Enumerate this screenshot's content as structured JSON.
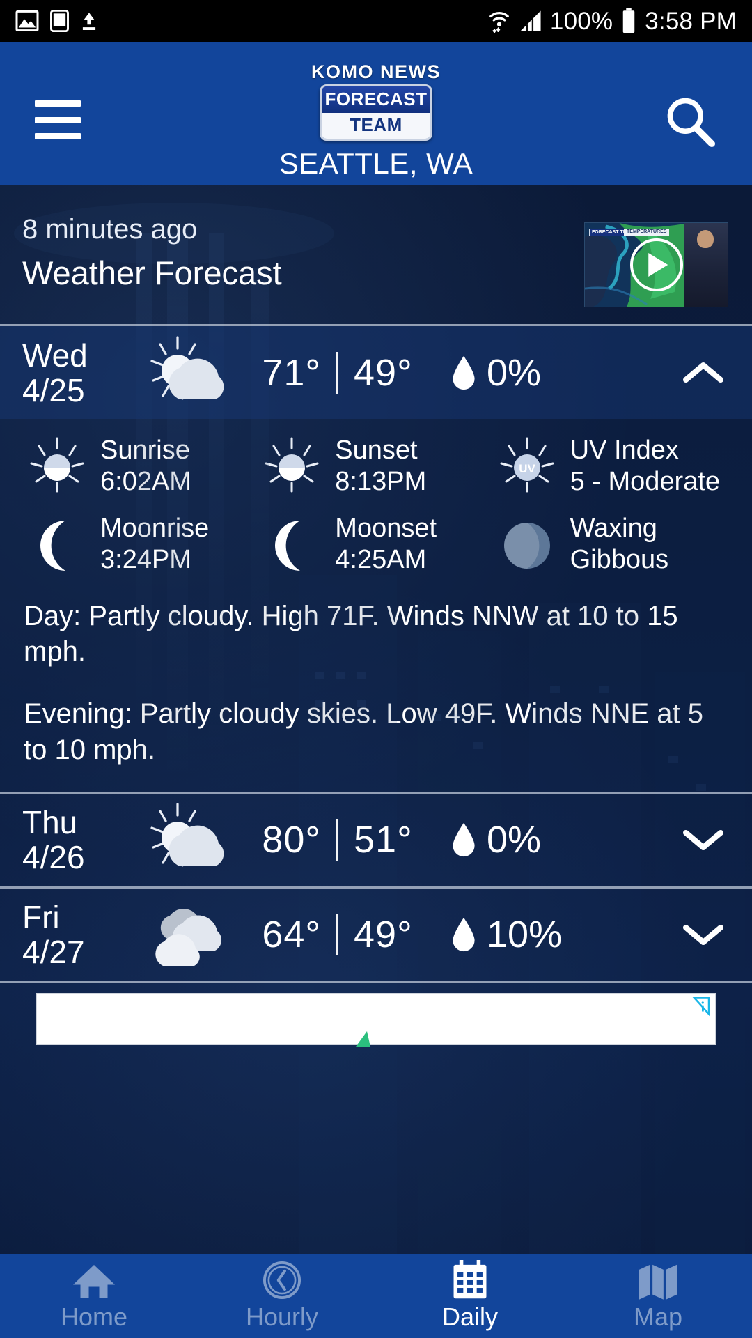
{
  "status_bar": {
    "icons_left": [
      "image-icon",
      "cast-screen-icon",
      "upload-icon"
    ],
    "icons_right": [
      "wifi-icon",
      "cell-signal-icon",
      "battery-icon"
    ],
    "battery": "100%",
    "time": "3:58 PM"
  },
  "header": {
    "menu_icon": "hamburger-menu-icon",
    "search_icon": "search-icon",
    "logo_line1": "KOMO NEWS",
    "logo_line2": "FORECAST",
    "logo_line3": "TEAM",
    "location": "SEATTLE, WA",
    "background_color": "#12459b"
  },
  "video": {
    "timestamp": "8 minutes ago",
    "title": "Weather Forecast",
    "play_icon": "play-button-icon",
    "thumbnail_label_1": "FORECAST TEAM",
    "thumbnail_label_2": "TEMPERATURES"
  },
  "forecast_days": [
    {
      "day": "Wed",
      "date": "4/25",
      "icon": "partly-cloudy-day-icon",
      "high": "71°",
      "low": "49°",
      "precip_icon": "raindrop-icon",
      "precip": "0%",
      "chevron": "chevron-up-icon",
      "expanded": true,
      "details": {
        "astro": [
          {
            "icon": "sunrise-icon",
            "label": "Sunrise",
            "value": "6:02AM"
          },
          {
            "icon": "sunset-icon",
            "label": "Sunset",
            "value": "8:13PM"
          },
          {
            "icon": "uv-index-icon",
            "label": "UV Index",
            "value": "5 - Moderate"
          },
          {
            "icon": "moonrise-icon",
            "label": "Moonrise",
            "value": "3:24PM"
          },
          {
            "icon": "moonset-icon",
            "label": "Moonset",
            "value": "4:25AM"
          },
          {
            "icon": "moon-phase-waxing-gibbous-icon",
            "label": "Waxing",
            "value": "Gibbous"
          }
        ],
        "day_text": "Day: Partly cloudy. High 71F. Winds NNW at 10 to 15 mph.",
        "evening_text": "Evening: Partly cloudy skies. Low 49F. Winds NNE at 5 to 10 mph."
      }
    },
    {
      "day": "Thu",
      "date": "4/26",
      "icon": "partly-cloudy-day-icon",
      "high": "80°",
      "low": "51°",
      "precip_icon": "raindrop-icon",
      "precip": "0%",
      "chevron": "chevron-down-icon",
      "expanded": false
    },
    {
      "day": "Fri",
      "date": "4/27",
      "icon": "cloudy-icon",
      "high": "64°",
      "low": "49°",
      "precip_icon": "raindrop-icon",
      "precip": "10%",
      "chevron": "chevron-down-icon",
      "expanded": false
    }
  ],
  "ad": {
    "adchoices_icon": "adchoices-icon"
  },
  "bottom_nav": {
    "items": [
      {
        "label": "Home",
        "icon": "home-icon",
        "active": false
      },
      {
        "label": "Hourly",
        "icon": "clock-icon",
        "active": false
      },
      {
        "label": "Daily",
        "icon": "calendar-icon",
        "active": true
      },
      {
        "label": "Map",
        "icon": "map-icon",
        "active": false
      }
    ],
    "active_color": "#ffffff",
    "inactive_color": "#7e9bc9",
    "background_color": "#12459b"
  }
}
